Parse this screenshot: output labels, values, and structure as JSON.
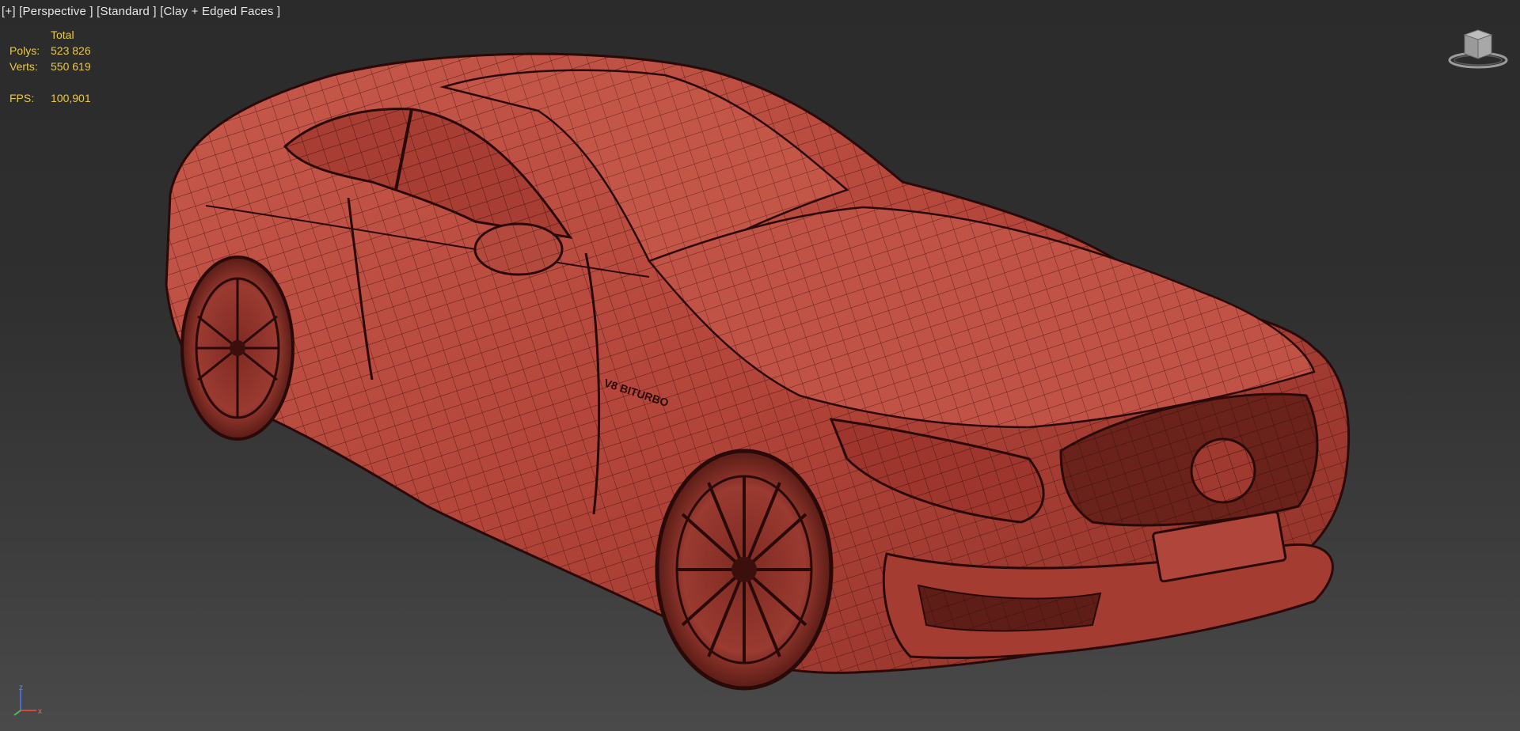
{
  "viewport": {
    "plus_menu": "[+]",
    "view_menu": "[Perspective ]",
    "shading_mode": "[Standard ]",
    "display_mode": "[Clay + Edged Faces ]"
  },
  "stats": {
    "header": "Total",
    "polys_label": "Polys:",
    "polys_value": "523 826",
    "verts_label": "Verts:",
    "verts_value": "550 619",
    "fps_label": "FPS:",
    "fps_value": "100,901"
  },
  "colors": {
    "label_text": "#e6e6e6",
    "stats_text": "#e8c84a",
    "clay_body": "#b4453a",
    "wire_edges": "#3b0f0c",
    "axis_x": "#d44a3a",
    "axis_y": "#4ac04a",
    "axis_z": "#4a6ad4"
  },
  "icons": {
    "viewcube": "viewcube-icon",
    "axis": "axis-tripod-icon"
  },
  "axis_tripod": {
    "x_label": "x",
    "z_label": "z"
  }
}
